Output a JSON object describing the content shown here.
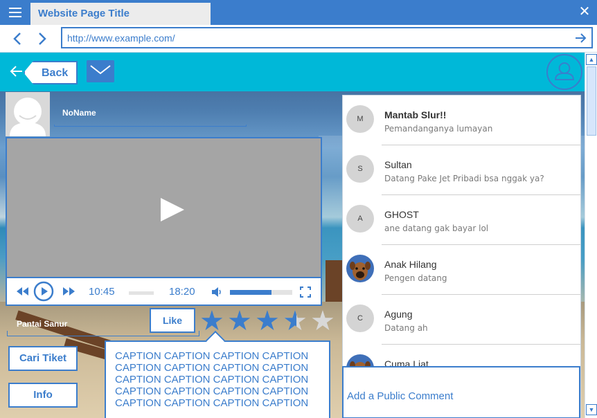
{
  "browser": {
    "tab_title": "Website Page Title",
    "url": "http://www.example.com/"
  },
  "header": {
    "back_label": "Back"
  },
  "profile": {
    "name": "NoName"
  },
  "video": {
    "current_time": "10:45",
    "duration": "18:20",
    "progress_fraction": 0.0,
    "volume_fraction": 0.67
  },
  "post": {
    "place": "Pantai Sanur",
    "like_label": "Like",
    "rating": 3.5,
    "rating_max": 5,
    "buttons": [
      {
        "label": "Cari Tiket"
      },
      {
        "label": "Info"
      }
    ],
    "caption_lines": [
      "CAPTION CAPTION CAPTION CAPTION",
      "CAPTION CAPTION CAPTION CAPTION",
      "CAPTION CAPTION CAPTION CAPTION",
      "CAPTION CAPTION CAPTION CAPTION",
      "CAPTION CAPTION CAPTION CAPTION"
    ]
  },
  "comments": {
    "items": [
      {
        "initial": "M",
        "name": "Mantab Slur!!",
        "text": "Pemandanganya lumayan",
        "bold": true,
        "avatar": "letter"
      },
      {
        "initial": "S",
        "name": "Sultan",
        "text": "Datang Pake Jet Pribadi bsa nggak ya?",
        "bold": false,
        "avatar": "letter"
      },
      {
        "initial": "A",
        "name": "GHOST",
        "text": "ane datang gak bayar lol",
        "bold": false,
        "avatar": "letter"
      },
      {
        "initial": "",
        "name": "Anak Hilang",
        "text": "Pengen datang",
        "bold": false,
        "avatar": "dog"
      },
      {
        "initial": "C",
        "name": "Agung",
        "text": "Datang ah",
        "bold": false,
        "avatar": "letter"
      },
      {
        "initial": "",
        "name": "Cuma Liat",
        "text": "",
        "bold": false,
        "avatar": "dog"
      }
    ],
    "add_placeholder": "Add a Public Comment"
  },
  "colors": {
    "accent": "#3b7dcc",
    "header_bg": "#00b8d8"
  }
}
